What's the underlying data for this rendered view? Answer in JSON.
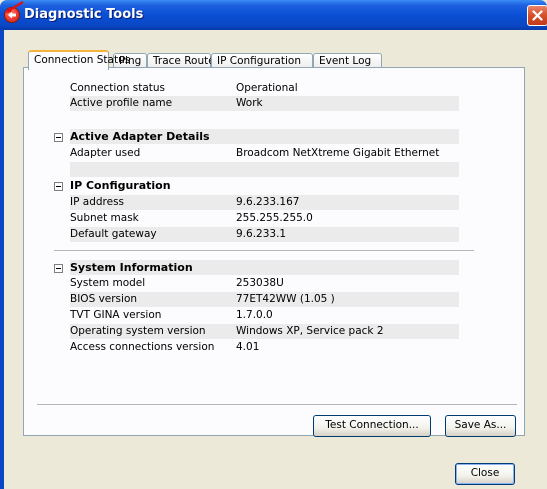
{
  "window": {
    "title": "Diagnostic Tools"
  },
  "tabs": [
    "Connection Status",
    "Ping",
    "Trace Route",
    "IP Configuration",
    "Event Log"
  ],
  "general": [
    {
      "label": "Connection status",
      "value": "Operational"
    },
    {
      "label": "Active profile name",
      "value": "Work"
    }
  ],
  "adapter": {
    "title": "Active Adapter Details",
    "rows": [
      {
        "label": "Adapter used",
        "value": "Broadcom NetXtreme Gigabit Ethernet"
      }
    ]
  },
  "ipconfig": {
    "title": "IP Configuration",
    "rows": [
      {
        "label": "IP address",
        "value": "9.6.233.167"
      },
      {
        "label": "Subnet mask",
        "value": "255.255.255.0"
      },
      {
        "label": "Default gateway",
        "value": "9.6.233.1"
      }
    ]
  },
  "system": {
    "title": "System Information",
    "rows": [
      {
        "label": "System model",
        "value": "253038U"
      },
      {
        "label": "BIOS version",
        "value": "77ET42WW (1.05 )"
      },
      {
        "label": "TVT GINA version",
        "value": "1.7.0.0"
      },
      {
        "label": "Operating system version",
        "value": "Windows XP,  Service pack 2"
      },
      {
        "label": "Access connections version",
        "value": "4.01"
      }
    ]
  },
  "buttons": {
    "test": "Test Connection...",
    "save": "Save As...",
    "close": "Close"
  }
}
